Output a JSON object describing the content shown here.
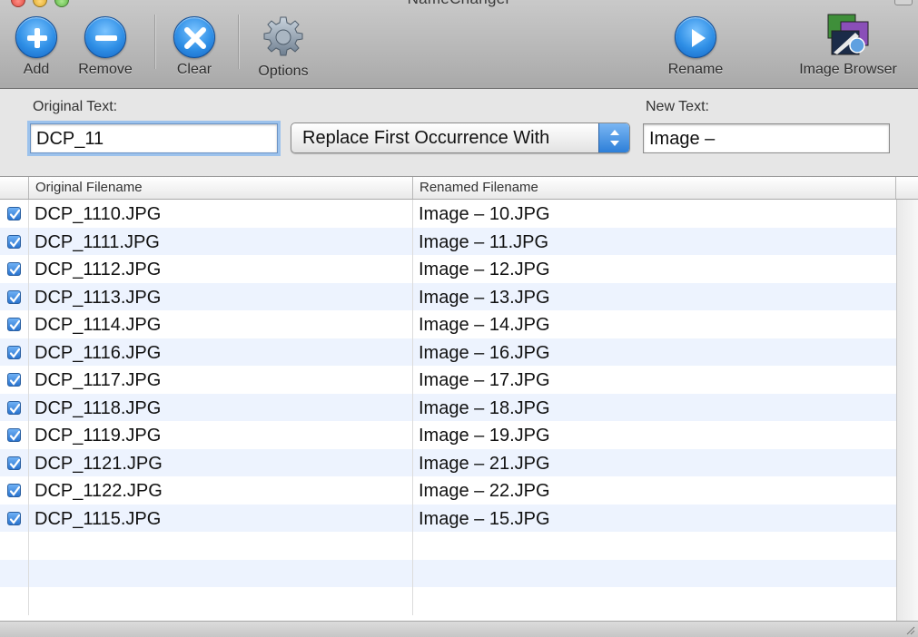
{
  "window": {
    "title": "NameChanger"
  },
  "toolbar": {
    "add_label": "Add",
    "remove_label": "Remove",
    "clear_label": "Clear",
    "options_label": "Options",
    "rename_label": "Rename",
    "image_browser_label": "Image Browser"
  },
  "form": {
    "original_text_label": "Original Text:",
    "original_text_value": "DCP_11",
    "mode_selected": "Replace First Occurrence With",
    "new_text_label": "New Text:",
    "new_text_value": "Image –"
  },
  "table": {
    "columns": [
      "",
      "Original Filename",
      "Renamed Filename"
    ],
    "rows": [
      {
        "checked": true,
        "original": "DCP_1110.JPG",
        "renamed": "Image – 10.JPG"
      },
      {
        "checked": true,
        "original": "DCP_1111.JPG",
        "renamed": "Image – 11.JPG"
      },
      {
        "checked": true,
        "original": "DCP_1112.JPG",
        "renamed": "Image – 12.JPG"
      },
      {
        "checked": true,
        "original": "DCP_1113.JPG",
        "renamed": "Image – 13.JPG"
      },
      {
        "checked": true,
        "original": "DCP_1114.JPG",
        "renamed": "Image – 14.JPG"
      },
      {
        "checked": true,
        "original": "DCP_1116.JPG",
        "renamed": "Image – 16.JPG"
      },
      {
        "checked": true,
        "original": "DCP_1117.JPG",
        "renamed": "Image – 17.JPG"
      },
      {
        "checked": true,
        "original": "DCP_1118.JPG",
        "renamed": "Image – 18.JPG"
      },
      {
        "checked": true,
        "original": "DCP_1119.JPG",
        "renamed": "Image – 19.JPG"
      },
      {
        "checked": true,
        "original": "DCP_1121.JPG",
        "renamed": "Image – 21.JPG"
      },
      {
        "checked": true,
        "original": "DCP_1122.JPG",
        "renamed": "Image – 22.JPG"
      },
      {
        "checked": true,
        "original": "DCP_1115.JPG",
        "renamed": "Image – 15.JPG"
      },
      {
        "checked": false,
        "original": "",
        "renamed": ""
      },
      {
        "checked": false,
        "original": "",
        "renamed": ""
      },
      {
        "checked": false,
        "original": "",
        "renamed": ""
      }
    ]
  },
  "icons": {
    "add": "plus-circle-icon",
    "remove": "minus-circle-icon",
    "clear": "x-circle-icon",
    "options": "gear-icon",
    "rename": "play-circle-icon",
    "image_browser": "image-browser-icon"
  },
  "colors": {
    "accent": "#2f8fe6",
    "alt_row": "#edf3fe"
  }
}
